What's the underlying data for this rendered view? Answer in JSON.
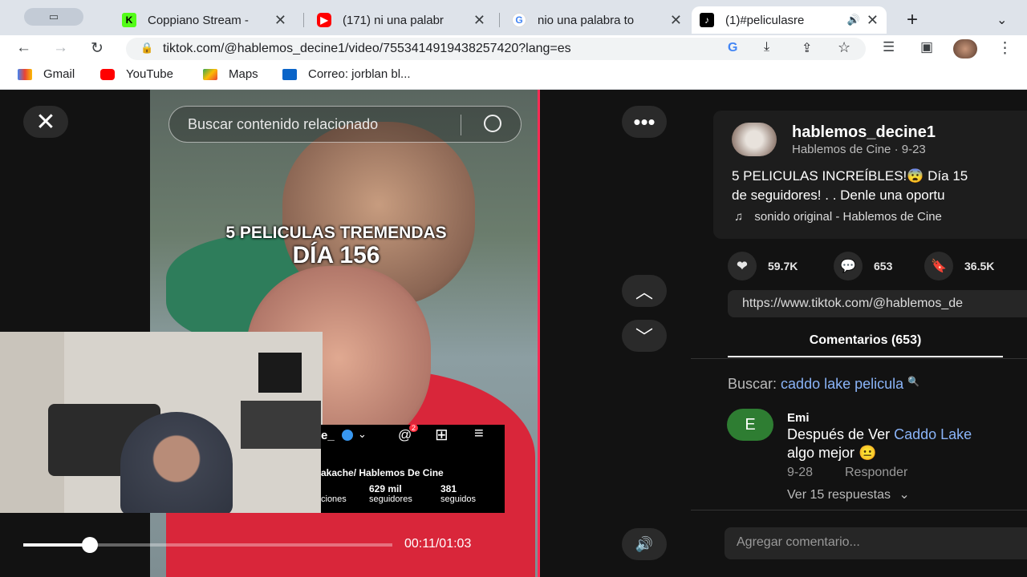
{
  "browser": {
    "tabs": [
      {
        "title": "Coppiano Stream -",
        "favicon": "kick-icon",
        "color": "#53fc18"
      },
      {
        "title": "(171) ni una palabr",
        "favicon": "youtube-icon",
        "color": "#ff0000"
      },
      {
        "title": "nio una palabra to",
        "favicon": "google-icon",
        "color": "#4285f4"
      },
      {
        "title": "(1)#peliculasre",
        "favicon": "tiktok-icon",
        "color": "#000000"
      }
    ],
    "url": "tiktok.com/@hablemos_decine1/video/7553414919438257420?lang=es",
    "bookmarks": [
      "Gmail",
      "YouTube",
      "Maps",
      "Correo: jorblan bl..."
    ]
  },
  "video": {
    "search_placeholder": "Buscar contenido relacionado",
    "overlay_line1": "5 PELICULAS TREMENDAS",
    "overlay_line2": "DÍA 156",
    "time": "00:11/01:03",
    "progress": 0.18
  },
  "instagram_overlay": {
    "username_fragment": "e_",
    "notification_count": "2",
    "bio_fragment": "akache/ Hablemos De Cine",
    "followers_value": "629 mil",
    "followers_label": "seguidores",
    "following_value": "381",
    "following_label": "seguidos",
    "posts_label_fragment": "ciones"
  },
  "post": {
    "username": "hablemos_decine1",
    "display_line": "Hablemos de Cine · 9-23",
    "caption_line1": "5 PELICULAS INCREÍBLES!😨 Día 15",
    "caption_line2": "de seguidores! . . Denle una oportu",
    "sound": "sonido original - Hablemos de Cine",
    "likes": "59.7K",
    "comments": "653",
    "saves": "36.5K",
    "link": "https://www.tiktok.com/@hablemos_de"
  },
  "comments": {
    "tab_label": "Comentarios (653)",
    "search_prefix": "Buscar:",
    "search_term": "caddo lake pelicula",
    "items": [
      {
        "avatar_letter": "E",
        "author": "Emi",
        "text_prefix": "Después de Ver ",
        "text_link": "Caddo Lake",
        "text_line2": "algo mejor 😐",
        "date": "9-28",
        "reply_label": "Responder",
        "replies_label": "Ver 15 respuestas"
      }
    ],
    "input_placeholder": "Agregar comentario..."
  },
  "colors": {
    "link_blue": "#8ab4f8",
    "avatar_green": "#2e7d32",
    "tiktok_accent": "#fe2c55"
  }
}
